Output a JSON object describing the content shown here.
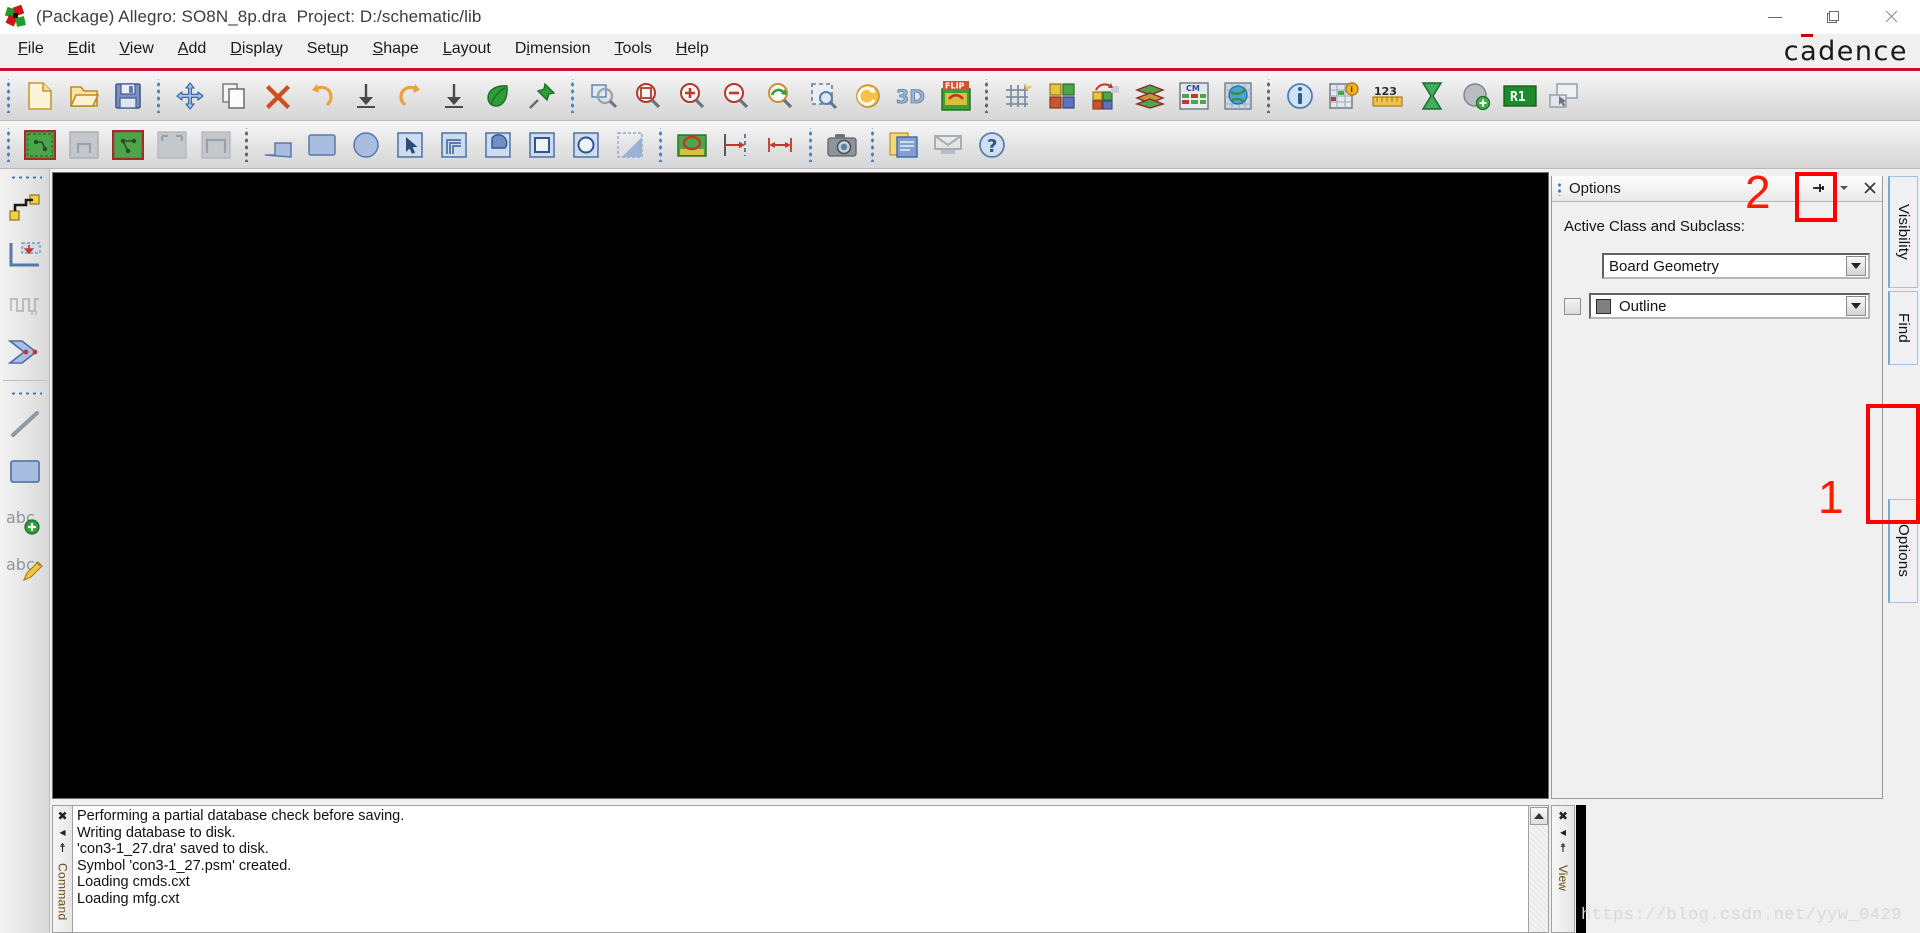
{
  "window": {
    "title_main": "(Package) Allegro: SO8N_8p.dra",
    "title_project": "Project: D:/schematic/lib",
    "app_icon": "allegro-icon",
    "minimize": "minimize-icon",
    "maximize": "restore-icon",
    "close": "close-icon"
  },
  "brand": {
    "logo_text": "cadence",
    "accent_color": "#c8102e"
  },
  "menu": {
    "items": [
      {
        "label": "File",
        "mnemonic": "F"
      },
      {
        "label": "Edit",
        "mnemonic": "E"
      },
      {
        "label": "View",
        "mnemonic": "V"
      },
      {
        "label": "Add",
        "mnemonic": "A"
      },
      {
        "label": "Display",
        "mnemonic": "D"
      },
      {
        "label": "Setup",
        "mnemonic": "u"
      },
      {
        "label": "Shape",
        "mnemonic": "S"
      },
      {
        "label": "Layout",
        "mnemonic": "L"
      },
      {
        "label": "Dimension",
        "mnemonic": "i"
      },
      {
        "label": "Tools",
        "mnemonic": "T"
      },
      {
        "label": "Help",
        "mnemonic": "H"
      }
    ]
  },
  "toolbar_primary": {
    "groups": [
      {
        "buttons": [
          {
            "name": "new-file-icon",
            "tip": "New"
          },
          {
            "name": "open-file-icon",
            "tip": "Open"
          },
          {
            "name": "save-icon",
            "tip": "Save"
          }
        ]
      },
      {
        "buttons": [
          {
            "name": "move-icon",
            "tip": "Move"
          },
          {
            "name": "copy-icon",
            "tip": "Copy"
          },
          {
            "name": "delete-icon",
            "tip": "Delete"
          },
          {
            "name": "undo-icon",
            "tip": "Undo"
          },
          {
            "name": "undo-to-icon",
            "tip": "Undo to"
          },
          {
            "name": "redo-icon",
            "tip": "Redo"
          },
          {
            "name": "redo-to-icon",
            "tip": "Redo to"
          },
          {
            "name": "leaf-icon",
            "tip": "Refresh"
          },
          {
            "name": "pin-icon",
            "tip": "Pin"
          }
        ]
      },
      {
        "buttons": [
          {
            "name": "zoom-fit-icon",
            "tip": "Zoom Fit"
          },
          {
            "name": "zoom-by-points-icon",
            "tip": "Zoom By Points"
          },
          {
            "name": "zoom-in-icon",
            "tip": "Zoom In"
          },
          {
            "name": "zoom-out-icon",
            "tip": "Zoom Out"
          },
          {
            "name": "zoom-previous-icon",
            "tip": "Zoom Previous"
          },
          {
            "name": "zoom-selection-icon",
            "tip": "Zoom Selection"
          },
          {
            "name": "redraw-icon",
            "tip": "Redraw"
          },
          {
            "name": "view-3d-icon",
            "tip": "3D View",
            "label": "3D"
          },
          {
            "name": "flip-design-icon",
            "tip": "Flip Design",
            "label": "FLIP"
          }
        ]
      },
      {
        "buttons": [
          {
            "name": "grid-toggle-icon",
            "tip": "Grid Toggle"
          },
          {
            "name": "color-visibility-icon",
            "tip": "Color / Visibility"
          },
          {
            "name": "subclass-visibility-icon",
            "tip": "Subclass Visibility"
          },
          {
            "name": "layer-stack-icon",
            "tip": "Cross Section"
          },
          {
            "name": "constraint-manager-icon",
            "tip": "Constraint Manager",
            "label": "CM"
          },
          {
            "name": "global-view-icon",
            "tip": "Global View"
          }
        ]
      },
      {
        "buttons": [
          {
            "name": "show-element-icon",
            "tip": "Show Element"
          },
          {
            "name": "report-icon",
            "tip": "Reports"
          },
          {
            "name": "measure-icon",
            "tip": "Measure",
            "label": "123"
          },
          {
            "name": "hourglass-icon",
            "tip": "Timing"
          },
          {
            "name": "add-pin-icon",
            "tip": "Add Pin"
          },
          {
            "name": "reference-designator-icon",
            "tip": "Reference Designator",
            "label": "R1"
          },
          {
            "name": "window-select-icon",
            "tip": "Window Select"
          }
        ]
      }
    ]
  },
  "toolbar_secondary": {
    "groups": [
      {
        "buttons": [
          {
            "name": "package-symbol-active-icon",
            "tip": "Package Symbol"
          },
          {
            "name": "mechanical-symbol-icon",
            "tip": "Mechanical Symbol"
          },
          {
            "name": "format-symbol-active-icon",
            "tip": "Format Symbol"
          },
          {
            "name": "shape-symbol-icon",
            "tip": "Shape Symbol"
          },
          {
            "name": "flash-symbol-icon",
            "tip": "Flash Symbol"
          }
        ]
      },
      {
        "buttons": [
          {
            "name": "add-line-icon",
            "tip": "Add Line"
          },
          {
            "name": "add-rectangle-icon",
            "tip": "Add Rectangle"
          },
          {
            "name": "add-circle-icon",
            "tip": "Add Circle"
          },
          {
            "name": "select-shape-icon",
            "tip": "Select Shape"
          },
          {
            "name": "shape-fill-icon",
            "tip": "Shape Fill"
          },
          {
            "name": "shape-arc-icon",
            "tip": "Arc"
          },
          {
            "name": "shape-polygon-icon",
            "tip": "Polygon"
          },
          {
            "name": "shape-rect-outline-icon",
            "tip": "Rectangle Outline"
          },
          {
            "name": "shape-circle-outline-icon",
            "tip": "Circle Outline"
          },
          {
            "name": "shape-gradient-icon",
            "tip": "Shape"
          }
        ]
      },
      {
        "buttons": [
          {
            "name": "place-component-icon",
            "tip": "Place Component"
          },
          {
            "name": "dimension-from-edge-icon",
            "tip": "Dimension From Edge"
          },
          {
            "name": "linear-dimension-icon",
            "tip": "Linear Dimension"
          }
        ]
      },
      {
        "buttons": [
          {
            "name": "screenshot-icon",
            "tip": "Screen Capture"
          }
        ]
      },
      {
        "buttons": [
          {
            "name": "notes-icon",
            "tip": "Notes"
          },
          {
            "name": "plot-icon",
            "tip": "Plot"
          },
          {
            "name": "help-icon",
            "tip": "Help"
          }
        ]
      }
    ]
  },
  "toolbar_left": {
    "groups": [
      {
        "buttons": [
          {
            "name": "add-connect-icon",
            "tip": "Add Connect"
          },
          {
            "name": "slide-icon",
            "tip": "Slide"
          },
          {
            "name": "delay-tune-icon",
            "tip": "Delay Tune",
            "disabled": true
          },
          {
            "name": "custom-smooth-icon",
            "tip": "Custom Smooth"
          }
        ]
      },
      {
        "buttons": [
          {
            "name": "line-tool-icon",
            "tip": "Line"
          },
          {
            "name": "rectangle-tool-icon",
            "tip": "Rectangle"
          },
          {
            "name": "add-text-icon",
            "tip": "Add Text",
            "label": "abc"
          },
          {
            "name": "edit-text-icon",
            "tip": "Edit Text",
            "label": "abc"
          }
        ]
      }
    ]
  },
  "options_panel": {
    "title": "Options",
    "pin_icon": "pin-icon",
    "dropdown_icon": "chevron-down-icon",
    "close_icon": "close-icon",
    "section_label": "Active Class and Subclass:",
    "class_value": "Board Geometry",
    "subclass_value": "Outline",
    "subclass_color": "#808080",
    "subclass_checked": false
  },
  "side_tabs": [
    {
      "label": "Visibility",
      "name": "tab-visibility"
    },
    {
      "label": "Find",
      "name": "tab-find"
    },
    {
      "label": "Options",
      "name": "tab-options"
    }
  ],
  "console": {
    "lines": [
      "Performing a partial database check before saving.",
      "Writing database to disk.",
      "'con3-1_27.dra' saved to disk.",
      "Symbol 'con3-1_27.psm' created.",
      "Loading cmds.cxt",
      "Loading mfg.cxt"
    ],
    "gutter_close": "✖",
    "gutter_collapse": "◂",
    "gutter_pin": "☨",
    "vertical_label": "Command",
    "scroll_up": "scroll-up-icon"
  },
  "view_strip": {
    "close": "✖",
    "collapse": "◂",
    "pin": "☨",
    "vertical_label": "View"
  },
  "annotations": [
    {
      "id": "1",
      "label": "1",
      "target": "options-tab-highlight",
      "color": "#ff1a00"
    },
    {
      "id": "2",
      "label": "2",
      "target": "pin-button-highlight",
      "color": "#ff1a00"
    }
  ],
  "watermark": {
    "text": "https://blog.csdn.net/yyw_0429"
  }
}
